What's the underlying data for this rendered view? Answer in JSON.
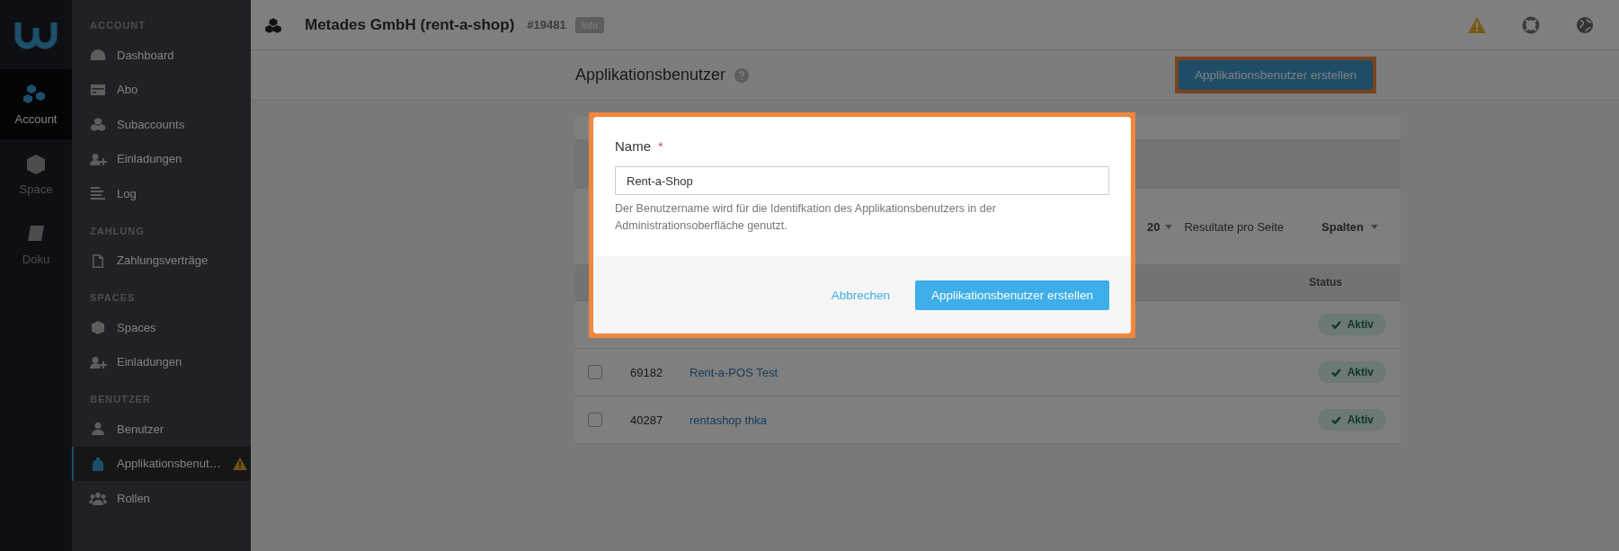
{
  "rail": [
    {
      "label": "Account",
      "selected": true
    },
    {
      "label": "Space",
      "selected": false
    },
    {
      "label": "Doku",
      "selected": false
    }
  ],
  "nav": [
    {
      "heading": "ACCOUNT",
      "items": [
        {
          "label": "Dashboard",
          "selected": false,
          "warning": false
        },
        {
          "label": "Abo",
          "selected": false,
          "warning": false
        },
        {
          "label": "Subaccounts",
          "selected": false,
          "warning": false
        },
        {
          "label": "Einladungen",
          "selected": false,
          "warning": false
        },
        {
          "label": "Log",
          "selected": false,
          "warning": false
        }
      ]
    },
    {
      "heading": "ZAHLUNG",
      "items": [
        {
          "label": "Zahlungsverträge",
          "selected": false,
          "warning": false
        }
      ]
    },
    {
      "heading": "SPACES",
      "items": [
        {
          "label": "Spaces",
          "selected": false,
          "warning": false
        },
        {
          "label": "Einladungen",
          "selected": false,
          "warning": false
        }
      ]
    },
    {
      "heading": "BENUTZER",
      "items": [
        {
          "label": "Benutzer",
          "selected": false,
          "warning": false
        },
        {
          "label": "Applikationsbenut…",
          "selected": true,
          "warning": true
        },
        {
          "label": "Rollen",
          "selected": false,
          "warning": false
        }
      ]
    }
  ],
  "header": {
    "title": "Metades GmbH (rent-a-shop)",
    "account_id": "#19481",
    "badge": "Info"
  },
  "page": {
    "title": "Applikationsbenutzer",
    "create_button": "Applikationsbenutzer erstellen",
    "create_button_highlighted": true
  },
  "table_controls": {
    "per_page": "20",
    "per_page_label": "Resultate pro Seite",
    "columns_button": "Spalten"
  },
  "table": {
    "columns": [
      "Status"
    ],
    "rows": [
      {
        "status": "Aktiv"
      },
      {
        "id": "69182",
        "name": "Rent-a-POS Test",
        "status": "Aktiv",
        "checked": false
      },
      {
        "id": "40287",
        "name": "rentashop thka",
        "status": "Aktiv",
        "checked": false
      }
    ]
  },
  "modal": {
    "label": "Name",
    "required": "*",
    "value": "Rent-a-Shop",
    "help": "Der Benutzername wird für die Identifkation des Applikationsbenutzers in der Administrationsoberfläche genutzt.",
    "cancel": "Abbrechen",
    "submit": "Applikationsbenutzer erstellen",
    "highlighted": true
  }
}
